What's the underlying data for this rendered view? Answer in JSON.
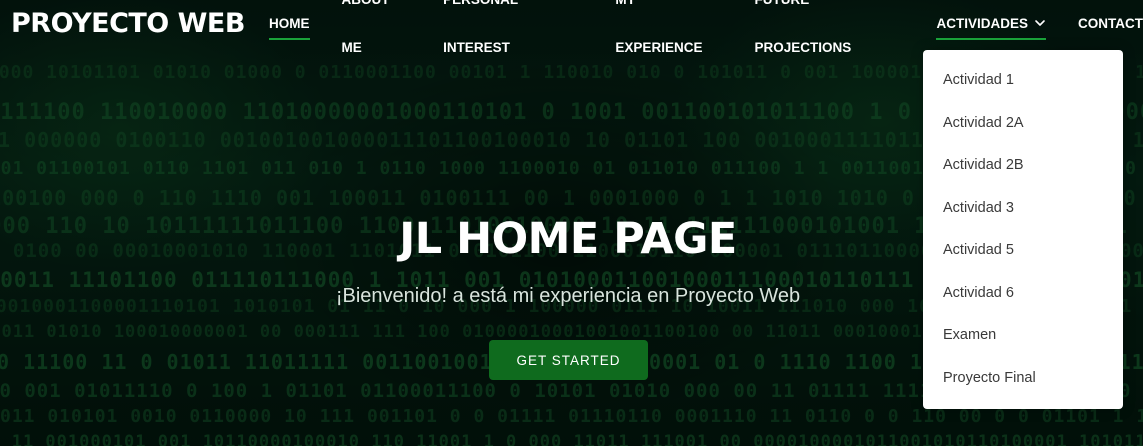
{
  "header": {
    "logo": "PROYECTO WEB",
    "nav": [
      {
        "label": "HOME",
        "active": true
      },
      {
        "label": "ABOUT ME"
      },
      {
        "label": "PERSONAL INTEREST"
      },
      {
        "label": "MY EXPERIENCE"
      },
      {
        "label": "FUTURE PROJECTIONS"
      },
      {
        "label": "ACTIVIDADES",
        "icon": "chevron-down-icon",
        "open": true
      },
      {
        "label": "CONTACT"
      }
    ]
  },
  "dropdown": {
    "items": [
      "Actividad 1",
      "Actividad 2A",
      "Actividad 2B",
      "Actividad 3",
      "Actividad 5",
      "Actividad 6",
      "Examen",
      "Proyecto Final"
    ]
  },
  "hero": {
    "title": "JL HOME PAGE",
    "subtitle": "¡Bienvenido! a está mi experiencia en Proyecto Web",
    "cta": "GET STARTED",
    "background": "binary-matrix-image"
  },
  "colors": {
    "accent": "#1aa33a",
    "cta_bg": "#0f6b1e",
    "background": "#03140d",
    "matrix_text": "#1f7a3a"
  }
}
